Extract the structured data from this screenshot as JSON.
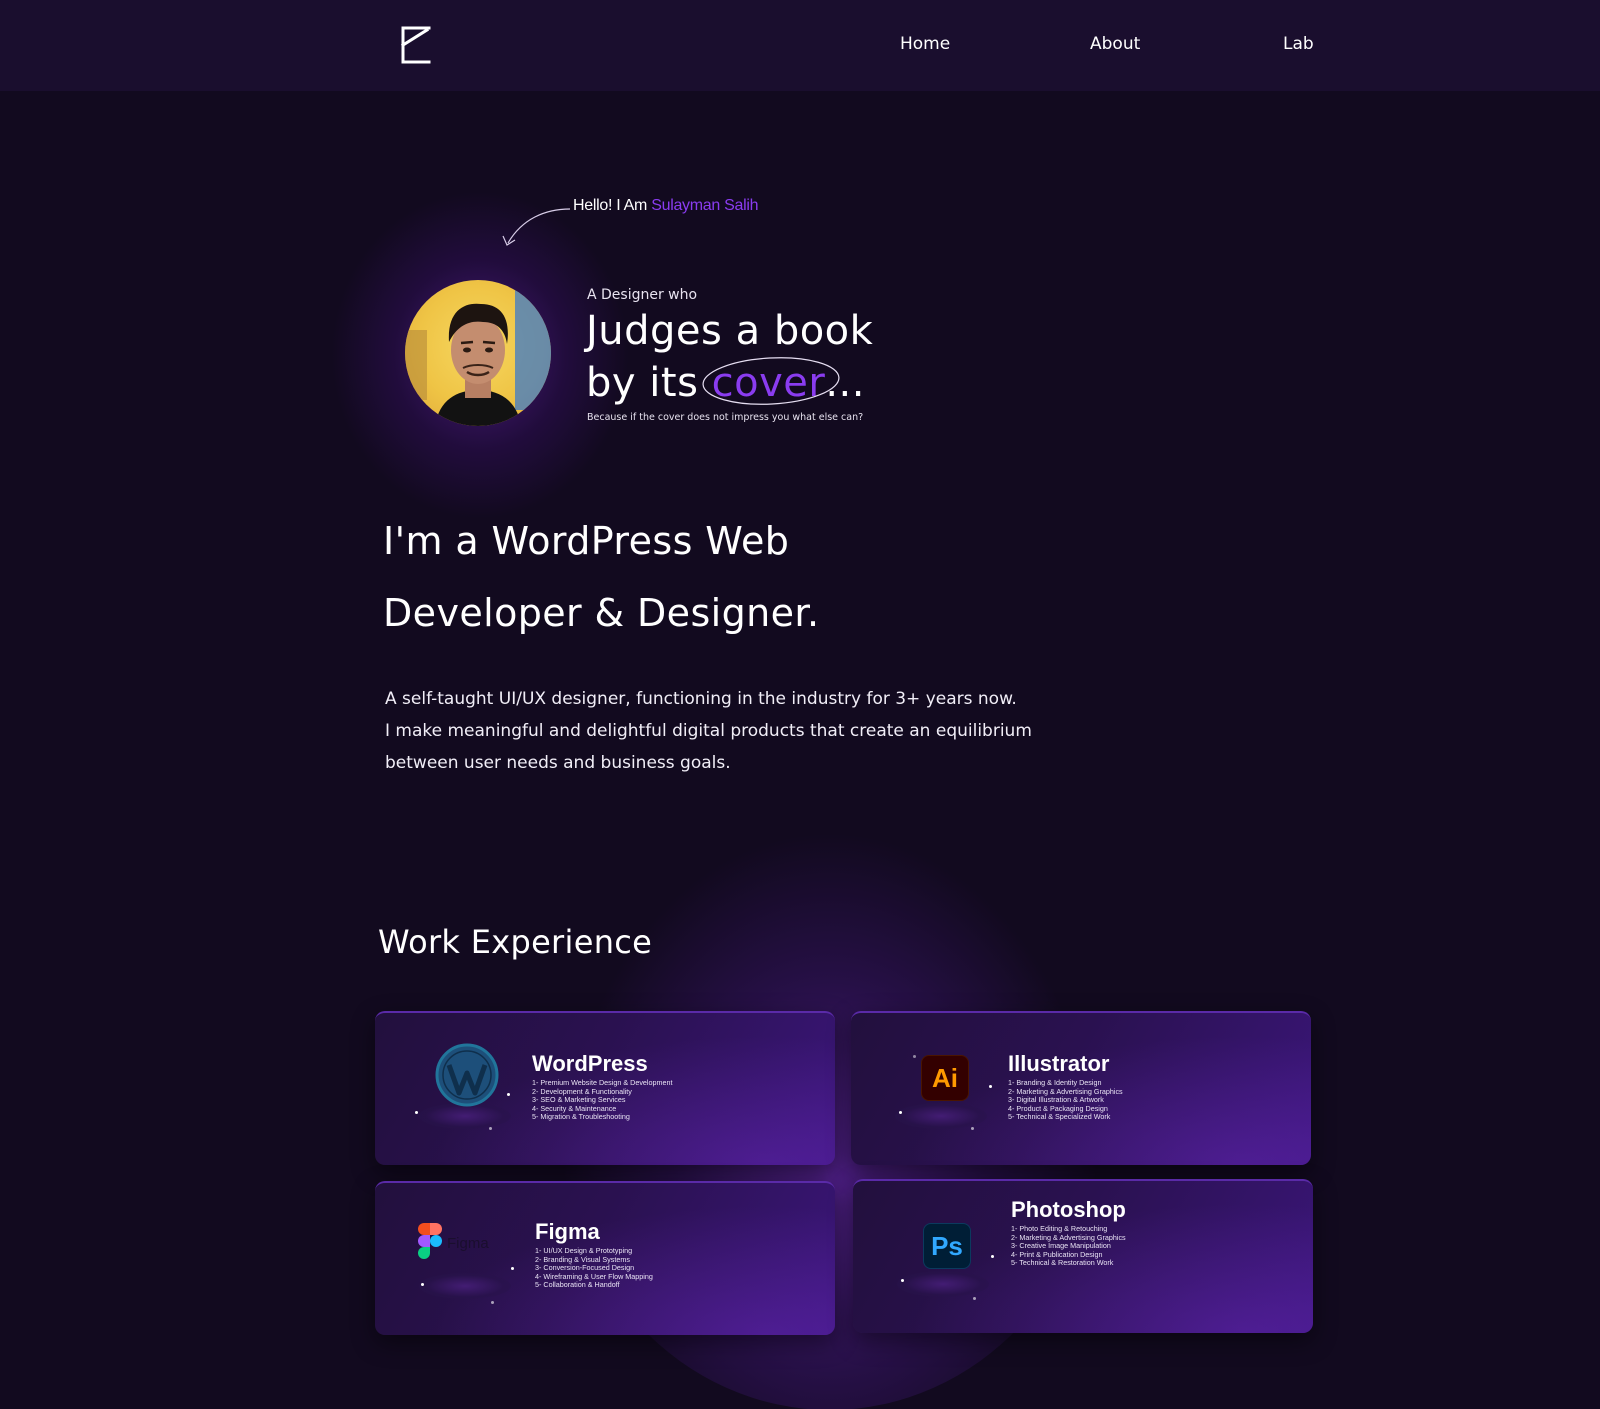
{
  "nav": {
    "links": [
      {
        "label": "Home"
      },
      {
        "label": "About"
      },
      {
        "label": "Lab"
      }
    ]
  },
  "hero": {
    "greeting": "Hello! I Am",
    "name": "Sulayman Salih",
    "sub_intro": "A Designer who",
    "headline_line1": "Judges a book",
    "headline_line2_prefix": "by its",
    "headline_highlight": "cover",
    "headline_suffix": "...",
    "tagline": "Because if the cover does not impress you what else can?"
  },
  "role": {
    "line1": "I'm a WordPress Web",
    "line2": "Developer & Designer."
  },
  "bio": {
    "lines": [
      "A self-taught UI/UX designer, functioning in the industry for 3+ years now.",
      "I make meaningful and delightful digital products that create an equilibrium",
      "between user needs and business goals."
    ]
  },
  "work": {
    "title": "Work Experience",
    "cards": [
      {
        "name": "WordPress",
        "icon": "wordpress-icon",
        "items": [
          "1- Premium Website Design & Development",
          "2- Development & Functionality",
          "3- SEO & Marketing Services",
          "4- Security & Maintenance",
          "5- Migration & Troubleshooting"
        ]
      },
      {
        "name": "Illustrator",
        "icon": "illustrator-icon",
        "badge": "Ai",
        "items": [
          "1- Branding & Identity Design",
          "2- Marketing & Advertising Graphics",
          "3- Digital Illustration & Artwork",
          "4- Product & Packaging Design",
          "5- Technical & Specialized Work"
        ]
      },
      {
        "name": "Figma",
        "icon": "figma-icon",
        "wordmark": "Figma",
        "items": [
          "1- UI/UX Design & Prototyping",
          "2- Branding & Visual Systems",
          "3- Conversion-Focused Design",
          "4- Wireframing & User Flow Mapping",
          "5- Collaboration & Handoff"
        ]
      },
      {
        "name": "Photoshop",
        "icon": "photoshop-icon",
        "badge": "Ps",
        "items": [
          "1- Photo Editing & Retouching",
          "2- Marketing & Advertising Graphics",
          "3- Creative Image Manipulation",
          "4- Print & Publication Design",
          "5- Technical & Restoration Work"
        ]
      }
    ]
  },
  "colors": {
    "background": "#120a1f",
    "nav_background": "#1a0e2e",
    "accent": "#8a3cf0",
    "illustrator_orange": "#ff9a00",
    "photoshop_blue": "#31a8ff"
  }
}
